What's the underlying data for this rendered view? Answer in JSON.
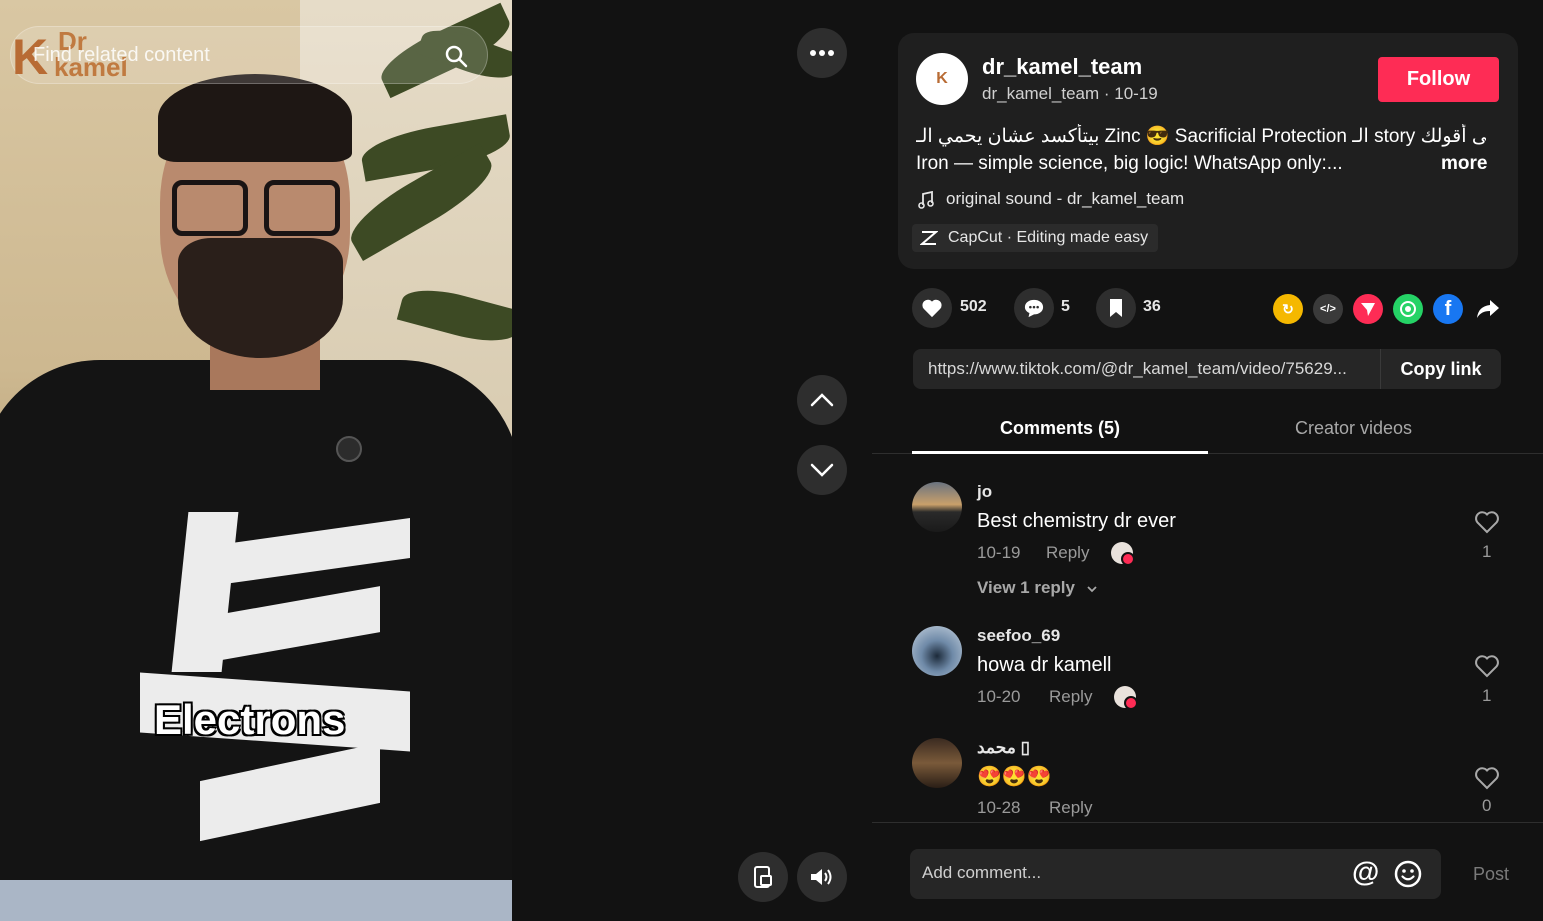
{
  "video": {
    "search_placeholder": "Find related content",
    "brand": {
      "k": "K",
      "dr": "Dr",
      "kamel": "kamel"
    },
    "caption": "Electrons"
  },
  "post": {
    "username": "dr_kamel_team",
    "handle_date": "dr_kamel_team · 10-19",
    "follow_label": "Follow",
    "description_line1": "بيتأكسد عشان يحمي الـ Zinc 😎 Sacrificial Protection الـ story تعالى أقولك",
    "description_line2": "Iron — simple science, big logic! WhatsApp only:...",
    "more_label": "more",
    "sound": "original sound - dr_kamel_team",
    "capcut": "CapCut · Editing made easy",
    "likes": "502",
    "comments": "5",
    "saves": "36",
    "link": "https://www.tiktok.com/@dr_kamel_team/video/75629...",
    "copy_link_label": "Copy link"
  },
  "tabs": {
    "comments": "Comments (5)",
    "creator": "Creator videos"
  },
  "comments": [
    {
      "user": "jo",
      "text": "Best chemistry dr ever",
      "date": "10-19",
      "reply": "Reply",
      "likes": "1",
      "view_replies": "View 1 reply"
    },
    {
      "user": "seefoo_69",
      "text": "howa dr kamell",
      "date": "10-20",
      "reply": "Reply",
      "likes": "1"
    },
    {
      "user": "محمد ▯",
      "text": "😍😍😍",
      "date": "10-28",
      "reply": "Reply",
      "likes": "0"
    }
  ],
  "composer": {
    "placeholder": "Add comment...",
    "at": "@",
    "post_label": "Post"
  },
  "colors": {
    "accent": "#fe2c55",
    "background": "#121212",
    "card": "#1f1f1f"
  }
}
